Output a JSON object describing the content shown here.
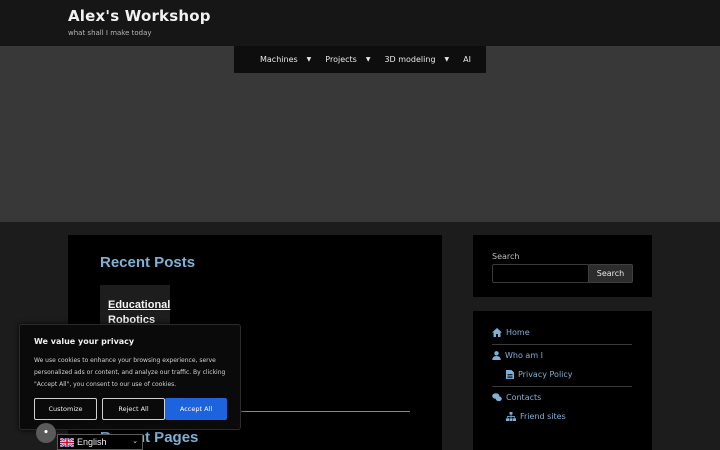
{
  "site": {
    "title": "Alex's Workshop",
    "tagline": "what shall I make today"
  },
  "nav": {
    "items": [
      {
        "label": "Machines",
        "has_dropdown": true
      },
      {
        "label": "Projects",
        "has_dropdown": true
      },
      {
        "label": "3D modeling",
        "has_dropdown": true
      },
      {
        "label": "AI",
        "has_dropdown": false
      }
    ]
  },
  "main": {
    "recent_posts_title": "Recent Posts",
    "post_title_line1": "Educational",
    "post_title_line2": "Robotics",
    "recent_pages_title": "Recent Pages"
  },
  "sidebar": {
    "search_label": "Search",
    "search_value": "",
    "search_button": "Search",
    "links": {
      "home": "Home",
      "who_am_i": "Who am I",
      "privacy_policy": "Privacy Policy",
      "contacts": "Contacts",
      "friend_sites": "Friend sites"
    }
  },
  "cookie": {
    "title": "We value your privacy",
    "text": "We use cookies to enhance your browsing experience, serve personalized ads or content, and analyze our traffic. By clicking \"Accept All\", you consent to our use of cookies.",
    "customize": "Customize",
    "reject": "Reject All",
    "accept": "Accept All",
    "accept_color": "#1d63dd"
  },
  "language": {
    "selected": "English",
    "flag": "uk-flag-icon"
  },
  "colors": {
    "link": "#7fb1d7",
    "heading": "#7fb1d7"
  }
}
